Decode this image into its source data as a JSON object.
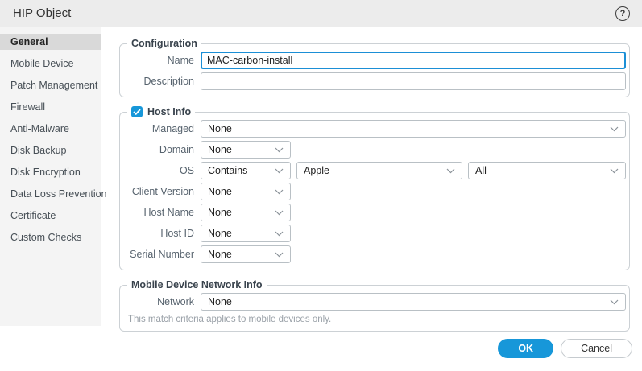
{
  "window": {
    "title": "HIP Object",
    "help_icon": "?"
  },
  "sidebar": {
    "selected": "General",
    "items": [
      "General",
      "Mobile Device",
      "Patch Management",
      "Firewall",
      "Anti-Malware",
      "Disk Backup",
      "Disk Encryption",
      "Data Loss Prevention",
      "Certificate",
      "Custom Checks"
    ]
  },
  "configuration": {
    "legend": "Configuration",
    "name_label": "Name",
    "name_value": "MAC-carbon-install",
    "description_label": "Description",
    "description_value": ""
  },
  "host_info": {
    "legend": "Host Info",
    "checkbox_checked": true,
    "managed_label": "Managed",
    "managed_value": "None",
    "domain_label": "Domain",
    "domain_value": "None",
    "os_label": "OS",
    "os_criteria": "Contains",
    "os_vendor": "Apple",
    "os_version": "All",
    "client_version_label": "Client Version",
    "client_version_value": "None",
    "host_name_label": "Host Name",
    "host_name_value": "None",
    "host_id_label": "Host ID",
    "host_id_value": "None",
    "serial_number_label": "Serial Number",
    "serial_number_value": "None"
  },
  "mobile_network": {
    "legend": "Mobile Device Network Info",
    "network_label": "Network",
    "network_value": "None",
    "note": "This match criteria applies to mobile devices only."
  },
  "footer": {
    "ok_label": "OK",
    "cancel_label": "Cancel"
  },
  "colors": {
    "accent_blue": "#1797d9",
    "focus_border": "#1b8fd6",
    "titlebar_bg": "#ececec",
    "sidebar_bg": "#f4f4f4",
    "sidebar_selected_bg": "#d9d9d9"
  }
}
